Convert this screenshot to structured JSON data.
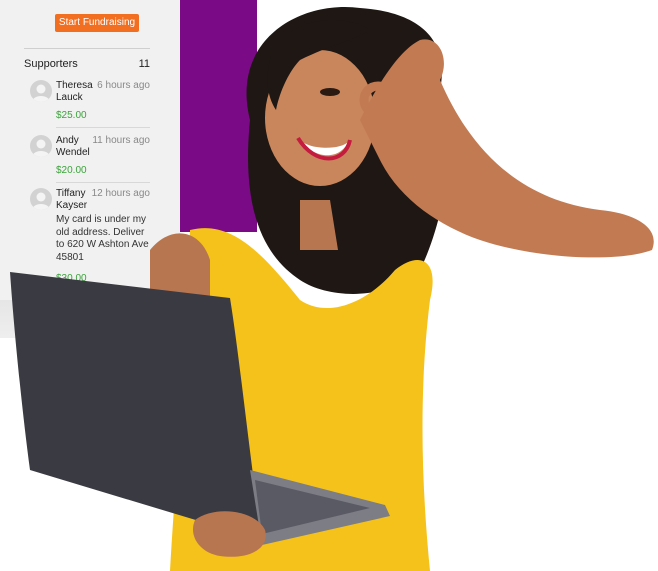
{
  "panel": {
    "start_button": "Start Fundraising",
    "supporters_label": "Supporters",
    "supporters_count": "11",
    "supporters": [
      {
        "name": "Theresa Lauck",
        "time": "6 hours ago",
        "amount": "$25.00",
        "message": ""
      },
      {
        "name": "Andy Wendel",
        "time": "11 hours ago",
        "amount": "$20.00",
        "message": ""
      },
      {
        "name": "Tiffany Kayser",
        "time": "12 hours ago",
        "amount": "$30.00",
        "message": "My card is under my old address. Deliver to 620 W Ashton Ave 45801"
      }
    ]
  },
  "colors": {
    "accent": "#f26f21",
    "purple": "#7b0a87",
    "amount_green": "#3aa33a",
    "dress_yellow": "#f5c21c",
    "laptop": "#3a3a42"
  },
  "icons": {
    "avatar": "user-avatar-icon"
  }
}
